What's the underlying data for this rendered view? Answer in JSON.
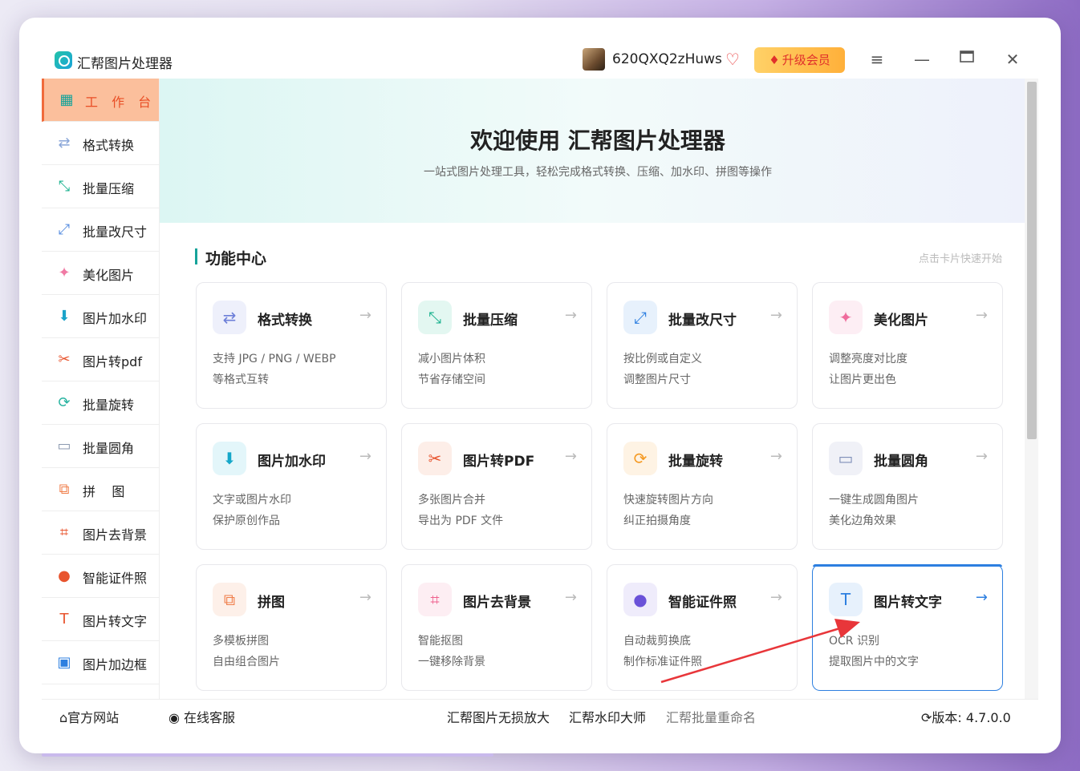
{
  "window": {
    "title": "汇帮图片处理器",
    "username": "620QXQ2zHuws",
    "upgrade_label": "升级会员"
  },
  "sidebar": {
    "items": [
      {
        "label": "工 作 台",
        "icon": "grid-icon",
        "color": "#16a39a",
        "glyph": "▦",
        "active": true
      },
      {
        "label": "格式转换",
        "icon": "convert-icon",
        "color": "#8aa6d8",
        "glyph": "⇄"
      },
      {
        "label": "批量压缩",
        "icon": "compress-icon",
        "color": "#1bb28f",
        "glyph": "⤡"
      },
      {
        "label": "批量改尺寸",
        "icon": "resize-icon",
        "color": "#5a8fe0",
        "glyph": "⤢"
      },
      {
        "label": "美化图片",
        "icon": "beautify-icon",
        "color": "#f07aa4",
        "glyph": "✦"
      },
      {
        "label": "图片加水印",
        "icon": "watermark-icon",
        "color": "#1aa3c9",
        "glyph": "⬇"
      },
      {
        "label": "图片转pdf",
        "icon": "pdf-icon",
        "color": "#e8542e",
        "glyph": "✂"
      },
      {
        "label": "批量旋转",
        "icon": "rotate-icon",
        "color": "#27b3a0",
        "glyph": "⟳"
      },
      {
        "label": "批量圆角",
        "icon": "rounded-corner-icon",
        "color": "#8c9ab0",
        "glyph": "▭"
      },
      {
        "label": "拼    图",
        "icon": "puzzle-icon",
        "color": "#f07e4a",
        "glyph": "⧉"
      },
      {
        "label": "图片去背景",
        "icon": "crop-icon",
        "color": "#e8542e",
        "glyph": "⌗"
      },
      {
        "label": "智能证件照",
        "icon": "id-photo-icon",
        "color": "#e8542e",
        "glyph": "●"
      },
      {
        "label": "图片转文字",
        "icon": "text-icon",
        "color": "#e8542e",
        "glyph": "T"
      },
      {
        "label": "图片加边框",
        "icon": "border-icon",
        "color": "#2d7fe0",
        "glyph": "▣"
      }
    ]
  },
  "hero": {
    "title": "欢迎使用 汇帮图片处理器",
    "subtitle": "一站式图片处理工具，轻松完成格式转换、压缩、加水印、拼图等操作"
  },
  "section": {
    "title": "功能中心",
    "hint": "点击卡片快速开始"
  },
  "cards": [
    {
      "title": "格式转换",
      "line1": "支持 JPG / PNG / WEBP",
      "line2": "等格式互转",
      "icon": "convert-icon",
      "glyph": "⇄",
      "color": "#6d7fd8",
      "bg": "#eef0fb"
    },
    {
      "title": "批量压缩",
      "line1": "减小图片体积",
      "line2": "节省存储空间",
      "icon": "compress-icon",
      "glyph": "⤡",
      "color": "#1bb28f",
      "bg": "#e3f7f1"
    },
    {
      "title": "批量改尺寸",
      "line1": "按比例或自定义",
      "line2": "调整图片尺寸",
      "icon": "resize-icon",
      "glyph": "⤢",
      "color": "#2d7fe0",
      "bg": "#e7f1fc"
    },
    {
      "title": "美化图片",
      "line1": "调整亮度对比度",
      "line2": "让图片更出色",
      "icon": "beautify-icon",
      "glyph": "✦",
      "color": "#ef6b9c",
      "bg": "#fdeef4"
    },
    {
      "title": "图片加水印",
      "line1": "文字或图片水印",
      "line2": "保护原创作品",
      "icon": "watermark-icon",
      "glyph": "⬇",
      "color": "#15a7c9",
      "bg": "#e3f6fa"
    },
    {
      "title": "图片转PDF",
      "line1": "多张图片合并",
      "line2": "导出为 PDF 文件",
      "icon": "pdf-icon",
      "glyph": "✂",
      "color": "#e8542e",
      "bg": "#fdeee8"
    },
    {
      "title": "批量旋转",
      "line1": "快速旋转图片方向",
      "line2": "纠正拍摄角度",
      "icon": "rotate-icon",
      "glyph": "⟳",
      "color": "#f59a23",
      "bg": "#fef3e4"
    },
    {
      "title": "批量圆角",
      "line1": "一键生成圆角图片",
      "line2": "美化边角效果",
      "icon": "rounded-corner-icon",
      "glyph": "▭",
      "color": "#7f8fb8",
      "bg": "#f0f1f7"
    },
    {
      "title": "拼图",
      "line1": "多模板拼图",
      "line2": "自由组合图片",
      "icon": "puzzle-icon",
      "glyph": "⧉",
      "color": "#f07e4a",
      "bg": "#fdf0e9"
    },
    {
      "title": "图片去背景",
      "line1": "智能抠图",
      "line2": "一键移除背景",
      "icon": "crop-icon",
      "glyph": "⌗",
      "color": "#ef5f8c",
      "bg": "#fdeef3"
    },
    {
      "title": "智能证件照",
      "line1": "自动裁剪换底",
      "line2": "制作标准证件照",
      "icon": "id-photo-icon",
      "glyph": "●",
      "color": "#6a52d8",
      "bg": "#efecfb"
    },
    {
      "title": "图片转文字",
      "line1": "OCR 识别",
      "line2": "提取图片中的文字",
      "icon": "text-icon",
      "glyph": "T",
      "color": "#2d7fe0",
      "bg": "#e7f1fc",
      "selected": true
    }
  ],
  "footer": {
    "website": "官方网站",
    "support": "在线客服",
    "link1": "汇帮图片无损放大",
    "link2": "汇帮水印大师",
    "link3": "汇帮批量重命名",
    "version": "版本:  4.7.0.0"
  }
}
